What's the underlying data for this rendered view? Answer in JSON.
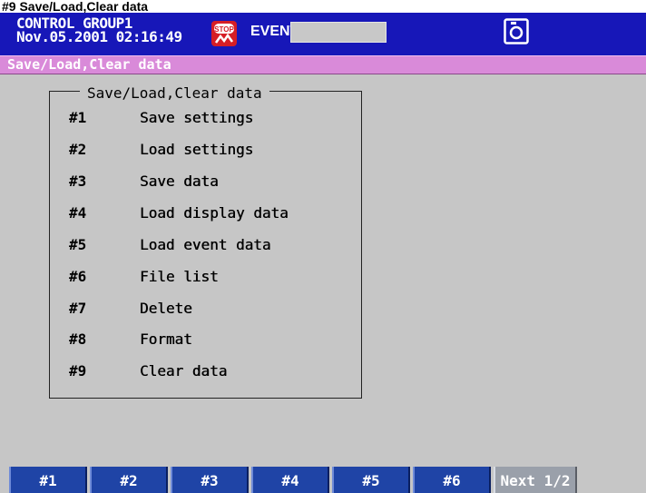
{
  "caption": "#9 Save/Load,Clear data",
  "status": {
    "group": "CONTROL GROUP1",
    "datetime": "Nov.05.2001 02:16:49",
    "stop_icon_text": "STOP",
    "event_label": "EVENT"
  },
  "title": "Save/Load,Clear data",
  "menu": {
    "title": "Save/Load,Clear data",
    "items": [
      {
        "num": "#1",
        "label": "Save settings"
      },
      {
        "num": "#2",
        "label": "Load settings"
      },
      {
        "num": "#3",
        "label": "Save data"
      },
      {
        "num": "#4",
        "label": "Load display data"
      },
      {
        "num": "#5",
        "label": "Load event data"
      },
      {
        "num": "#6",
        "label": "File list"
      },
      {
        "num": "#7",
        "label": "Delete"
      },
      {
        "num": "#8",
        "label": "Format"
      },
      {
        "num": "#9",
        "label": "Clear data"
      }
    ]
  },
  "softkeys": [
    "#1",
    "#2",
    "#3",
    "#4",
    "#5",
    "#6",
    "Next 1/2"
  ],
  "colors": {
    "status_bar": "#1717b8",
    "title_bar": "#d98ad9",
    "background": "#c6c6c6",
    "softkey": "#1f44a6",
    "softkey_next": "#9aa0aa",
    "stop_icon": "#d61e26"
  }
}
